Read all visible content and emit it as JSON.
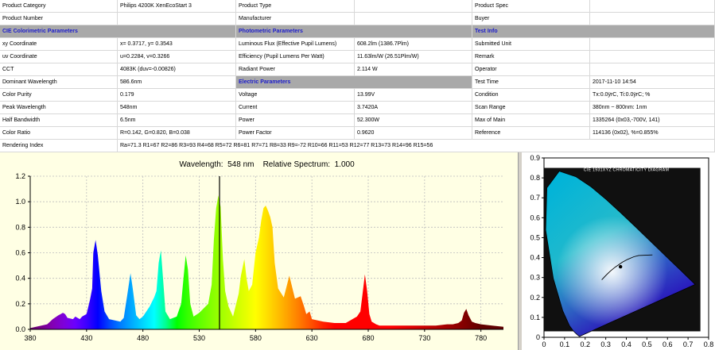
{
  "table": {
    "rows": [
      [
        "Product Category",
        "Philips 4200K XenEcoStart 3",
        "Product Type",
        "",
        "Product Spec",
        ""
      ],
      [
        "Product Number",
        "",
        "Manufacturer",
        "",
        "Buyer",
        ""
      ],
      [
        "CIE Colorimetric Parameters",
        "",
        "Photometric Parameters",
        "",
        "Test Info",
        ""
      ],
      [
        "xy Coordinate",
        "x= 0.3717, y= 0.3543",
        "Luminous Flux (Effective Pupil Lumens)",
        "608.2lm (1386.7Plm)",
        "Submitted Unit",
        ""
      ],
      [
        "uv Coordinate",
        "u=0.2284, v=0.3266",
        "Efficiency (Pupil Lumens Per Watt)",
        "11.63lm/W (26.51Plm/W)",
        "Remark",
        ""
      ],
      [
        "CCT",
        "4083K (duv=-0.00826)",
        "Radiant Power",
        "2.114 W",
        "Operator",
        ""
      ],
      [
        "Dominant Wavelength",
        "586.6nm",
        "Electric Parameters",
        "",
        "Test Time",
        "2017-11-10 14:54"
      ],
      [
        "Color Purity",
        "0.179",
        "Voltage",
        "13.99V",
        "Condition",
        "Tx:0.0ÿrC, Ti:0.0ÿrC; %"
      ],
      [
        "Peak Wavelength",
        "548nm",
        "Current",
        "3.7420A",
        "Scan Range",
        "380nm ~ 800nm: 1nm"
      ],
      [
        "Half Bandwidth",
        "6.5nm",
        "Power",
        "52.300W",
        "Max of Main",
        "1335264 (0x03,-700V, 141)"
      ],
      [
        "Color Ratio",
        "R=0.142, G=0.820, B=0.038",
        "Power Factor",
        "0.9620",
        "Reference",
        "114136 (0x02), %=0.855%"
      ],
      [
        "Rendering Index",
        "Ra=71.3  R1=67 R2=86 R3=93 R4=68 R5=72 R6=81 R7=71 R8=33 R9=-72 R10=66 R11=53 R12=77 R13=73 R14=96 R15=56",
        "",
        "",
        "",
        ""
      ]
    ]
  },
  "chart_data": [
    {
      "type": "area",
      "title": "Wavelength:  548 nm    Relative Spectrum:  1.000",
      "xlabel": "",
      "ylabel": "",
      "xlim": [
        380,
        800
      ],
      "ylim": [
        0,
        1.2
      ],
      "x_ticks": [
        "380",
        "430",
        "480",
        "530",
        "580",
        "630",
        "680",
        "730",
        "780"
      ],
      "y_ticks": [
        "0.0",
        "0.2",
        "0.4",
        "0.6",
        "0.8",
        "1.0",
        "1.2"
      ],
      "marker_x": 548,
      "grid": true,
      "series": [
        {
          "x": [
            380,
            395,
            400,
            405,
            407,
            409,
            411,
            413,
            418,
            420,
            424,
            426,
            428,
            430,
            433,
            435,
            436,
            438,
            440,
            443,
            446,
            450,
            460,
            463,
            466,
            469,
            471,
            474,
            477,
            480,
            486,
            490,
            492,
            494,
            496,
            498,
            500,
            504,
            510,
            514,
            516,
            518,
            520,
            522,
            525,
            530,
            538,
            541,
            543,
            545,
            547,
            548,
            549,
            551,
            553,
            556,
            560,
            565,
            567,
            570,
            572,
            574,
            577,
            580,
            583,
            585,
            587,
            589,
            591,
            593,
            595,
            597,
            600,
            605,
            610,
            615,
            620,
            623,
            625,
            628,
            630,
            640,
            650,
            660,
            670,
            673,
            675,
            677,
            679,
            681,
            683,
            687,
            690,
            700,
            710,
            720,
            730,
            740,
            750,
            755,
            760,
            763,
            765,
            767,
            769,
            772,
            775,
            780,
            790,
            800
          ],
          "y": [
            0.01,
            0.04,
            0.08,
            0.11,
            0.12,
            0.13,
            0.12,
            0.09,
            0.08,
            0.1,
            0.08,
            0.1,
            0.11,
            0.12,
            0.23,
            0.32,
            0.6,
            0.7,
            0.58,
            0.3,
            0.14,
            0.08,
            0.06,
            0.09,
            0.26,
            0.44,
            0.32,
            0.11,
            0.08,
            0.1,
            0.18,
            0.25,
            0.3,
            0.52,
            0.62,
            0.38,
            0.14,
            0.08,
            0.1,
            0.2,
            0.4,
            0.58,
            0.47,
            0.2,
            0.1,
            0.13,
            0.2,
            0.35,
            0.7,
            0.95,
            1.05,
            1.0,
            0.96,
            0.55,
            0.3,
            0.18,
            0.1,
            0.28,
            0.42,
            0.55,
            0.4,
            0.3,
            0.35,
            0.6,
            0.72,
            0.85,
            0.95,
            0.97,
            0.93,
            0.88,
            0.8,
            0.52,
            0.32,
            0.25,
            0.42,
            0.24,
            0.26,
            0.18,
            0.12,
            0.14,
            0.08,
            0.06,
            0.05,
            0.05,
            0.1,
            0.14,
            0.28,
            0.43,
            0.3,
            0.12,
            0.06,
            0.04,
            0.03,
            0.03,
            0.03,
            0.03,
            0.03,
            0.03,
            0.04,
            0.04,
            0.05,
            0.07,
            0.13,
            0.16,
            0.11,
            0.06,
            0.05,
            0.04,
            0.03,
            0.02
          ]
        }
      ]
    },
    {
      "type": "scatter",
      "title": "CIE 1931XYZ CHROMATICITY DIAGRAM",
      "xlabel": "",
      "ylabel": "",
      "xlim": [
        0,
        0.8
      ],
      "ylim": [
        0,
        0.9
      ],
      "x_ticks": [
        "0",
        "0.1",
        "0.2",
        "0.3",
        "0.4",
        "0.5",
        "0.6",
        "0.7",
        "0.8"
      ],
      "y_ticks": [
        "0",
        "0.1",
        "0.2",
        "0.3",
        "0.4",
        "0.5",
        "0.6",
        "0.7",
        "0.8",
        "0.9"
      ],
      "point": {
        "x": 0.3717,
        "y": 0.3543
      },
      "locus": {
        "x": [
          0.1741,
          0.1738,
          0.1733,
          0.1714,
          0.1689,
          0.1644,
          0.1566,
          0.144,
          0.1241,
          0.0913,
          0.0454,
          0.0082,
          0.0139,
          0.0743,
          0.1547,
          0.2296,
          0.3016,
          0.3731,
          0.4441,
          0.5125,
          0.5752,
          0.627,
          0.6658,
          0.6915,
          0.7079,
          0.719,
          0.7347
        ],
        "y": [
          0.005,
          0.0049,
          0.0048,
          0.0051,
          0.0069,
          0.0109,
          0.0177,
          0.0297,
          0.0578,
          0.1327,
          0.295,
          0.5384,
          0.7502,
          0.8338,
          0.8059,
          0.7543,
          0.6923,
          0.6245,
          0.5547,
          0.4866,
          0.4242,
          0.3725,
          0.334,
          0.3083,
          0.292,
          0.2809,
          0.2653
        ]
      },
      "planck": {
        "x": [
          0.5267,
          0.4599,
          0.4369,
          0.4053,
          0.3805,
          0.3451,
          0.3221,
          0.3064,
          0.2952,
          0.2807
        ],
        "y": [
          0.4133,
          0.4106,
          0.4041,
          0.3907,
          0.3768,
          0.3516,
          0.3318,
          0.3166,
          0.3048,
          0.2884
        ]
      }
    }
  ]
}
